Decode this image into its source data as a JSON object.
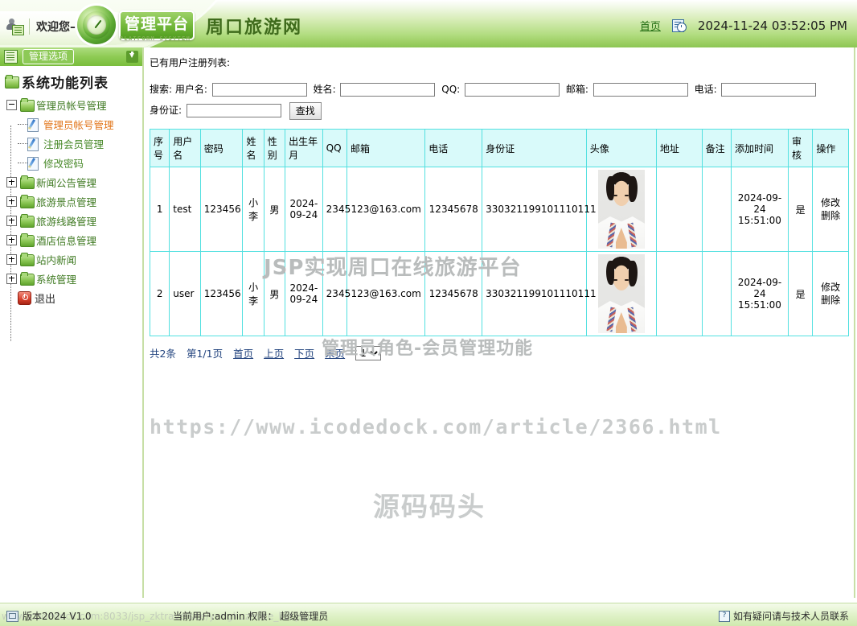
{
  "header": {
    "welcome": "欢迎您–",
    "brand_cn": "管理平台",
    "brand_en": "PLATFORM SYSYTEM",
    "site_title": "周口旅游网",
    "home_link": "首页",
    "datetime": "2024-11-24 03:52:05 PM",
    "user_icon": "user-card-icon",
    "clock_icon": "date-time-icon",
    "logo_icon": "gauge-logo-icon"
  },
  "sidebar": {
    "head_label": "管理选项",
    "head_icon": "grid-icon",
    "collapse_icon": "arrow-down-icon",
    "tree_title": "系统功能列表",
    "items": [
      {
        "label": "管理员帐号管理",
        "level": 1,
        "expander": "minus",
        "icon": "folder-open-icon",
        "active": false
      },
      {
        "label": "管理员帐号管理",
        "level": 2,
        "expander": "none",
        "icon": "pencil-icon",
        "active": true
      },
      {
        "label": "注册会员管理",
        "level": 2,
        "expander": "none",
        "icon": "pencil-icon",
        "active": false
      },
      {
        "label": "修改密码",
        "level": 2,
        "expander": "none",
        "icon": "pencil-icon",
        "active": false
      },
      {
        "label": "新闻公告管理",
        "level": 1,
        "expander": "plus",
        "icon": "folder-icon",
        "active": false
      },
      {
        "label": "旅游景点管理",
        "level": 1,
        "expander": "plus",
        "icon": "folder-icon",
        "active": false
      },
      {
        "label": "旅游线路管理",
        "level": 1,
        "expander": "plus",
        "icon": "folder-icon",
        "active": false
      },
      {
        "label": "酒店信息管理",
        "level": 1,
        "expander": "plus",
        "icon": "folder-icon",
        "active": false
      },
      {
        "label": "站内新闻",
        "level": 1,
        "expander": "plus",
        "icon": "folder-icon",
        "active": false
      },
      {
        "label": "系统管理",
        "level": 1,
        "expander": "plus",
        "icon": "folder-icon",
        "active": false
      },
      {
        "label": "退出",
        "level": 1,
        "expander": "none",
        "icon": "logout-icon",
        "active": false
      }
    ]
  },
  "main": {
    "caption": "已有用户注册列表:",
    "search": {
      "prefix": "搜索:",
      "fields": [
        {
          "label": "用户名:",
          "value": "",
          "name": "username"
        },
        {
          "label": "姓名:",
          "value": "",
          "name": "realname"
        },
        {
          "label": "QQ:",
          "value": "",
          "name": "qq"
        },
        {
          "label": "邮箱:",
          "value": "",
          "name": "email"
        },
        {
          "label": "电话:",
          "value": "",
          "name": "phone"
        },
        {
          "label": "身份证:",
          "value": "",
          "name": "idcard"
        }
      ],
      "button": "查找"
    },
    "table": {
      "columns": [
        "序号",
        "用户名",
        "密码",
        "姓名",
        "性别",
        "出生年月",
        "QQ",
        "邮箱",
        "电话",
        "身份证",
        "头像",
        "地址",
        "备注",
        "添加时间",
        "审核",
        "操作"
      ],
      "rows": [
        {
          "index": "1",
          "username": "test",
          "password": "123456",
          "realname": "小李",
          "gender": "男",
          "birth": "2024-09-24",
          "qq": "2345",
          "email": "123@163.com",
          "phone": "12345678",
          "idcard": "330321199101110111",
          "avatar": "user-avatar-photo",
          "address": "",
          "remark": "",
          "added": "2024-09-24 15:51:00",
          "audit": "是",
          "ops": [
            "修改",
            "删除"
          ]
        },
        {
          "index": "2",
          "username": "user",
          "password": "123456",
          "realname": "小李",
          "gender": "男",
          "birth": "2024-09-24",
          "qq": "2345",
          "email": "123@163.com",
          "phone": "12345678",
          "idcard": "330321199101110111",
          "avatar": "user-avatar-photo",
          "address": "",
          "remark": "",
          "added": "2024-09-24 15:51:00",
          "audit": "是",
          "ops": [
            "修改",
            "删除"
          ]
        }
      ]
    },
    "pager": {
      "total": "共2条",
      "page_of": "第1/1页",
      "first": "首页",
      "prev": "上页",
      "next": "下页",
      "last": "末页",
      "selected_page": "1",
      "page_options": [
        "1"
      ]
    },
    "watermarks": {
      "line1": "JSP实现周口在线旅游平台",
      "line2": "管理员角色-会员管理功能",
      "url": "https://www.icodedock.com/article/2366.html",
      "brand": "源码码头"
    }
  },
  "footer": {
    "version": "版本2024 V1.0",
    "user_info": "当前用户:admin 权限： 超级管理员",
    "help": "如有疑问请与技术人员联系",
    "status_url": "www.icodedock.com:8033/jsp_zktravelsite/yonghuzhuce_list.jsp",
    "monitor_icon": "monitor-icon",
    "help_icon": "question-mark-icon"
  },
  "colors": {
    "header_green": "#8cc653",
    "brand_green": "#4f9c1e",
    "table_border": "#52e0e0",
    "table_header_bg": "#d9fafa",
    "link_blue": "#22437e",
    "active_orange": "#e2761b"
  }
}
